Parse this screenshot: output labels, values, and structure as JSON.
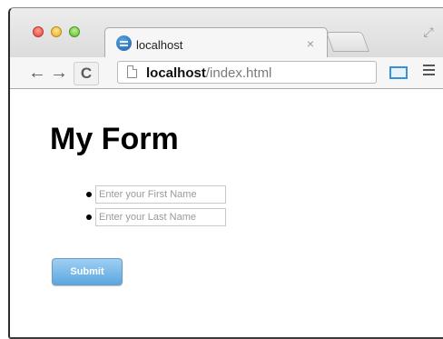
{
  "window": {
    "tab": {
      "title": "localhost",
      "close_glyph": "×"
    },
    "toolbar": {
      "back_glyph": "←",
      "forward_glyph": "→",
      "reload_glyph": "C",
      "url_host": "localhost",
      "url_path": "/index.html"
    }
  },
  "page": {
    "heading": "My Form",
    "first_name": {
      "value": "",
      "placeholder": "Enter your First Name"
    },
    "last_name": {
      "value": "",
      "placeholder": "Enter your Last Name"
    },
    "submit_label": "Submit"
  },
  "icons": {
    "favicon": "globe-icon",
    "page": "page-icon",
    "cast": "cast-icon",
    "menu": "hamburger-menu-icon",
    "fullscreen": "fullscreen-icon"
  },
  "colors": {
    "submit_button": "#5ba7e0",
    "cast_icon": "#3d8ed8"
  }
}
